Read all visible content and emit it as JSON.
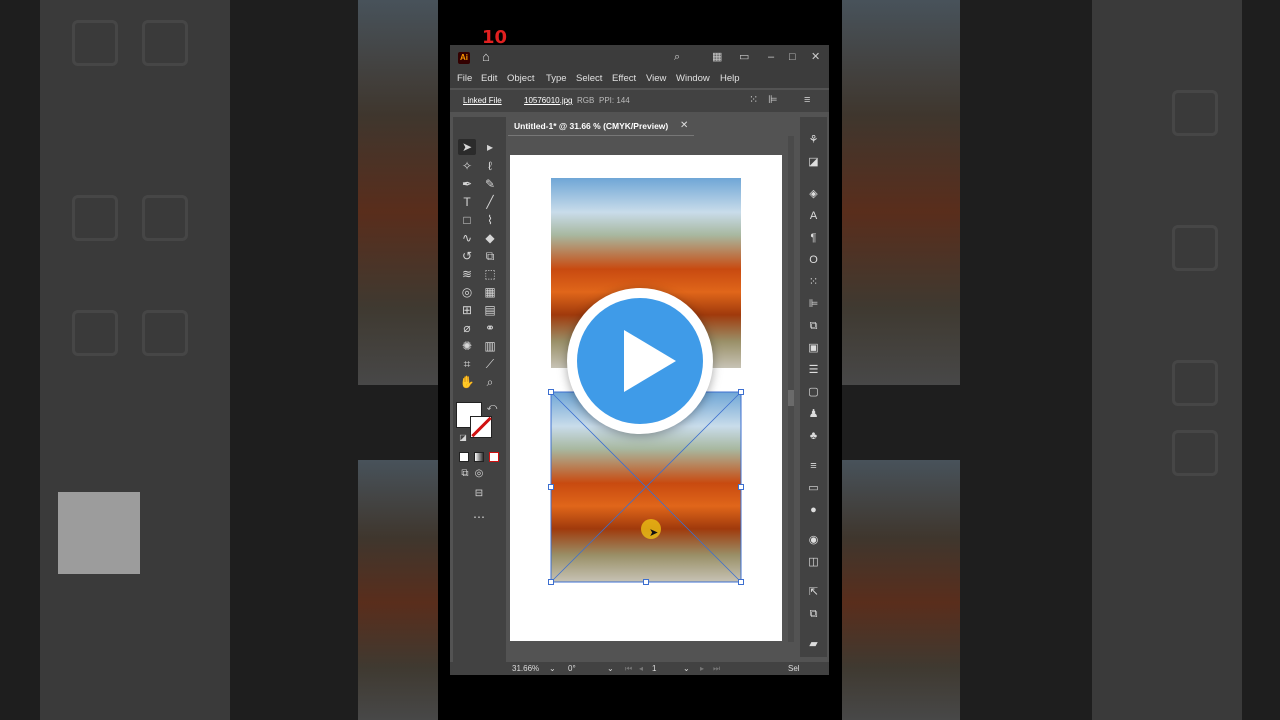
{
  "app": {
    "logo": "Ai",
    "menu": [
      "File",
      "Edit",
      "Object",
      "Type",
      "Select",
      "Effect",
      "View",
      "Window",
      "Help"
    ],
    "control_bar": {
      "linked_label": "Linked File",
      "filename": "10576010.jpg",
      "color_mode": "RGB",
      "ppi": "PPI: 144"
    },
    "document_tab": {
      "title": "Untitled-1* @ 31.66 % (CMYK/Preview)"
    },
    "status": {
      "zoom": "31.66%",
      "rotate": "0°",
      "artboard": "1",
      "mode": "Sel"
    }
  },
  "overlay": {
    "corner_mark": "10"
  },
  "colors": {
    "play_blue": "#3f9be8",
    "panel_dark": "#3c3c3c",
    "panel_mid": "#535353"
  }
}
